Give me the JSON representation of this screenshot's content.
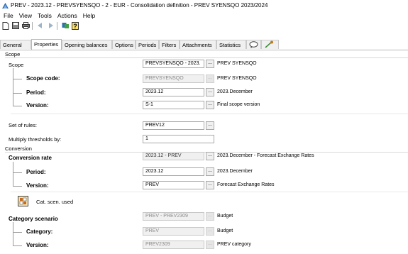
{
  "window": {
    "title": "PREV - 2023.12 - PREVSYENSQO - 2 - EUR - Consolidation definition - PREV SYENSQO 2023/2024"
  },
  "menu": [
    "File",
    "View",
    "Tools",
    "Actions",
    "Help"
  ],
  "tabs": [
    "General",
    "Properties",
    "Opening balances",
    "Options",
    "Periods",
    "Filters",
    "Attachments",
    "Statistics"
  ],
  "active_tab": "Properties",
  "scope": {
    "group_label": "Scope",
    "scope_label": "Scope",
    "scope_value": "PREVSYENSQO - 2023.",
    "scope_desc": "PREV SYENSQO",
    "code_label": "Scope code:",
    "code_value": "PREVSYENSQO",
    "code_desc": "PREV SYENSQO",
    "period_label": "Period:",
    "period_value": "2023.12",
    "period_desc": "2023.December",
    "version_label": "Version:",
    "version_value": "S-1",
    "version_desc": "Final scope version"
  },
  "rules": {
    "set_label": "Set of rules:",
    "set_value": "PREV12",
    "mult_label": "Multiply thresholds by:",
    "mult_value": "1"
  },
  "conversion": {
    "group_label": "Conversion",
    "rate_label": "Conversion rate",
    "rate_value": "2023.12 - PREV",
    "rate_desc": "2023.December - Forecast Exchange Rates",
    "period_label": "Period:",
    "period_value": "2023.12",
    "period_desc": "2023.December",
    "version_label": "Version:",
    "version_value": "PREV",
    "version_desc": "Forecast Exchange Rates"
  },
  "category": {
    "used_label": "Cat. scen. used",
    "scenario_label": "Category scenario",
    "scenario_value": "PREV - PREV2309",
    "scenario_desc": "Budget",
    "cat_label": "Category:",
    "cat_value": "PREV",
    "cat_desc": "Budget",
    "version_label": "Version:",
    "version_value": "PREV2309",
    "version_desc": "PREV category"
  },
  "ellipsis": "..."
}
